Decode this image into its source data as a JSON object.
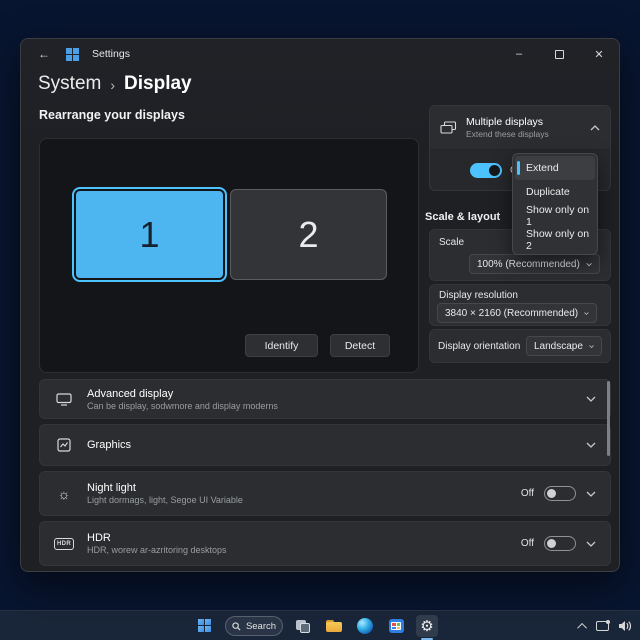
{
  "window": {
    "title": "Settings",
    "back_glyph": "←",
    "breadcrumb": {
      "root": "System",
      "sep": "›",
      "current": "Display"
    },
    "controls": {
      "minimize": "–",
      "close": "✕"
    }
  },
  "display_section": {
    "title": "Rearrange your displays",
    "monitors": [
      {
        "label": "1"
      },
      {
        "label": "2"
      }
    ],
    "identify": "Identify",
    "detect": "Detect"
  },
  "multiple_displays": {
    "title": "Multiple displays",
    "subtitle": "Extend these displays",
    "toggle_label": "Cn",
    "menu": [
      "Extend",
      "Duplicate",
      "Show only on 1",
      "Show only on 2"
    ],
    "selected": "Extend"
  },
  "scale_layout": {
    "heading": "Scale & layout",
    "scale_label": "Scale",
    "scale_value": "100% (Recommended)",
    "resolution_label": "Display resolution",
    "resolution_value": "3840 × 2160 (Recommended)",
    "orientation_label": "Display orientation",
    "orientation_value": "Landscape"
  },
  "rows": [
    {
      "title": "Advanced display",
      "subtitle": "Can be display, sodwmore and display moderns"
    },
    {
      "title": "Graphics",
      "subtitle": ""
    },
    {
      "title": "Night light",
      "subtitle": "Light dormags, light, Segoe UI Variable",
      "state": "Off"
    },
    {
      "title": "HDR",
      "subtitle": "HDR, worew ar-azritoring desktops",
      "state": "Off",
      "icon_text": "HDR"
    }
  ],
  "taskbar": {
    "search": "Search"
  },
  "icons": {
    "gear": "⚙",
    "night_light": "☼"
  },
  "colors": {
    "accent": "#4cc2ff",
    "monitor_selected": "#4db6f0",
    "taskbar": "#1a2738"
  }
}
